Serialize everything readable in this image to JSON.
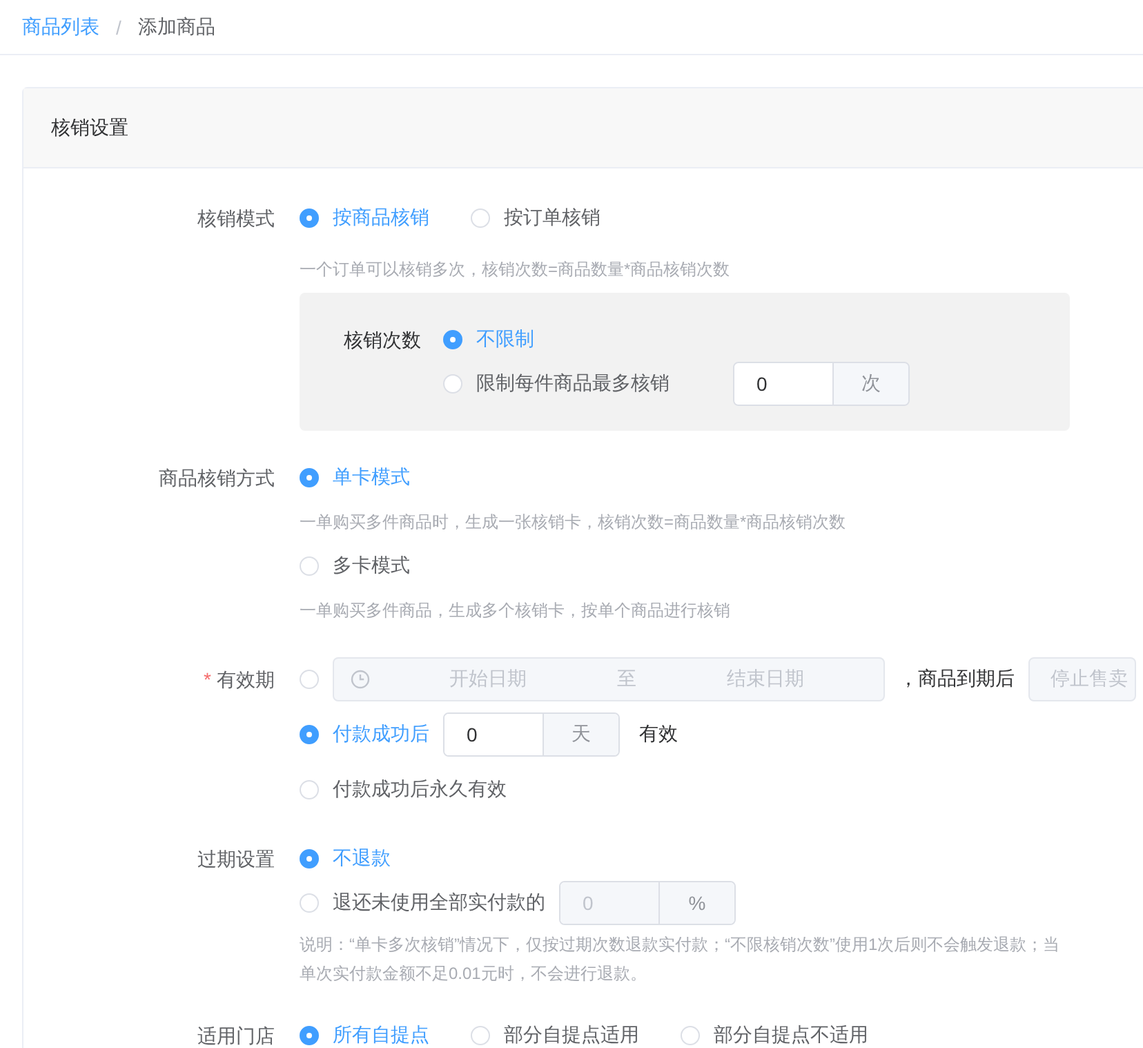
{
  "breadcrumb": [
    {
      "label": "商品列表",
      "link": true
    },
    {
      "label": "添加商品",
      "link": false
    }
  ],
  "breadcrumb_separator": "/",
  "section": {
    "title": "核销设置"
  },
  "fields": [
    {
      "label": "核销模式",
      "inline": true,
      "options": [
        {
          "kind": "plain",
          "label": "按商品核销",
          "selected": true
        },
        {
          "kind": "plain",
          "label": "按订单核销",
          "selected": false
        }
      ],
      "hint": "一个订单可以核销多次，核销次数=商品数量*商品核销次数",
      "panel": {
        "label": "核销次数",
        "options": [
          {
            "kind": "plain",
            "label": "不限制",
            "selected": true
          },
          {
            "kind": "input",
            "label": "限制每件商品最多核销",
            "selected": false,
            "value": "0",
            "unit": "次",
            "disabled": false
          }
        ]
      }
    },
    {
      "label": "商品核销方式",
      "options": [
        {
          "kind": "plain",
          "label": "单卡模式",
          "selected": true,
          "hint": "一单购买多件商品时，生成一张核销卡，核销次数=商品数量*商品核销次数"
        },
        {
          "kind": "plain",
          "label": "多卡模式",
          "selected": false,
          "hint": "一单购买多件商品，生成多个核销卡，按单个商品进行核销"
        }
      ]
    },
    {
      "label": "有效期",
      "required_mark": "*",
      "options": [
        {
          "kind": "range",
          "selected": false,
          "start_placeholder": "开始日期",
          "separator": "至",
          "end_placeholder": "结束日期",
          "suffix": "，商品到期后",
          "select_placeholder": "停止售卖"
        },
        {
          "kind": "input",
          "label": "付款成功后",
          "selected": true,
          "value": "0",
          "unit": "天",
          "disabled": false,
          "suffix": "有效"
        },
        {
          "kind": "plain",
          "label": "付款成功后永久有效",
          "selected": false
        }
      ]
    },
    {
      "label": "过期设置",
      "options": [
        {
          "kind": "plain",
          "label": "不退款",
          "selected": true
        },
        {
          "kind": "input",
          "label": "退还未使用全部实付款的",
          "selected": false,
          "value": "0",
          "unit": "%",
          "disabled": true
        }
      ],
      "note": "说明：“单卡多次核销”情况下，仅按过期次数退款实付款；“不限核销次数”使用1次后则不会触发退款；当单次实付款金额不足0.01元时，不会进行退款。"
    },
    {
      "label": "适用门店",
      "inline": true,
      "options": [
        {
          "kind": "plain",
          "label": "所有自提点",
          "selected": true
        },
        {
          "kind": "plain",
          "label": "部分自提点适用",
          "selected": false
        },
        {
          "kind": "plain",
          "label": "部分自提点不适用",
          "selected": false
        }
      ]
    }
  ]
}
